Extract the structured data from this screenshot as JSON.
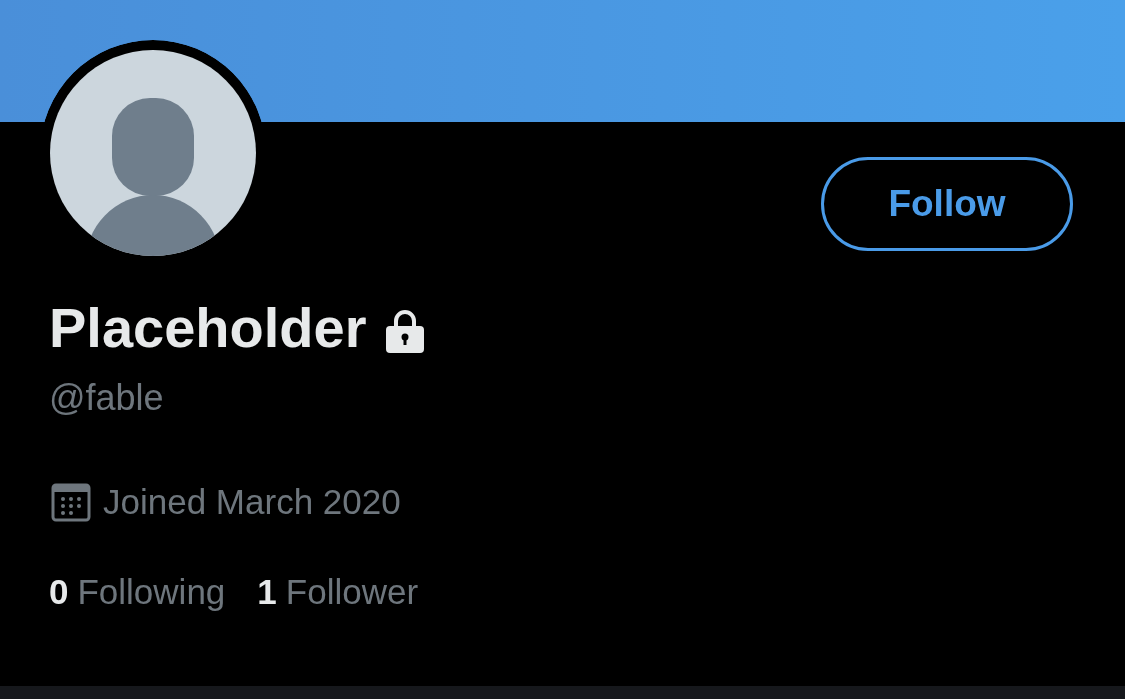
{
  "profile": {
    "name": "Placeholder",
    "protected": true,
    "handle": "@fable",
    "joined": "Joined March 2020",
    "stats": [
      {
        "count": "0",
        "label": "Following"
      },
      {
        "count": "1",
        "label": "Follower"
      }
    ]
  },
  "follow_button": {
    "label": "Follow"
  }
}
